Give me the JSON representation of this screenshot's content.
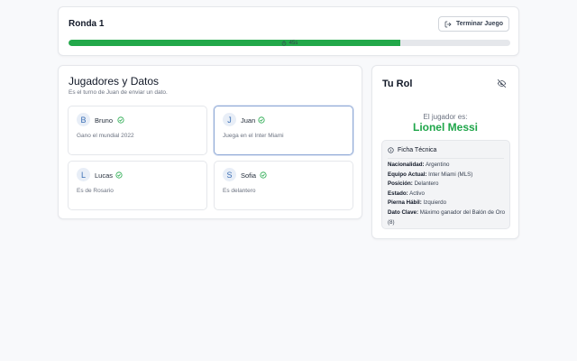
{
  "round": {
    "title": "Ronda 1",
    "end_label": "Terminar Juego",
    "progress_percent": 75,
    "progress_label": "45s"
  },
  "players_panel": {
    "title": "Jugadores y Datos",
    "subtitle": "Es el turno de Juan de enviar un dato.",
    "players": [
      {
        "initial": "B",
        "name": "Bruno",
        "clue": "Gano el mundial 2022",
        "active": false
      },
      {
        "initial": "J",
        "name": "Juan",
        "clue": "Juega en el Inter Miami",
        "active": true
      },
      {
        "initial": "L",
        "name": "Lucas",
        "clue": "Es de Rosario",
        "active": false
      },
      {
        "initial": "S",
        "name": "Sofia",
        "clue": "Es delantero",
        "active": false
      }
    ]
  },
  "role": {
    "title": "Tu Rol",
    "prefix": "El jugador es:",
    "player_name": "Lionel Messi",
    "sheet_title": "Ficha Técnica",
    "sheet": [
      {
        "label": "Nacionalidad:",
        "value": "Argentino"
      },
      {
        "label": "Equipo Actual:",
        "value": "Inter Miami (MLS)"
      },
      {
        "label": "Posición:",
        "value": "Delantero"
      },
      {
        "label": "Estado:",
        "value": "Activo"
      },
      {
        "label": "Pierna Hábil:",
        "value": "Izquierdo"
      },
      {
        "label": "Dato Clave:",
        "value": "Máximo ganador del Balón de Oro (8)"
      }
    ]
  },
  "colors": {
    "accent_green": "#22a84a",
    "active_border": "#8fa9d6",
    "avatar_text": "#3b6fb5"
  },
  "icons": {
    "end": "logout-icon",
    "timer": "timer-icon",
    "check": "check-circle-icon",
    "hide": "eye-off-icon",
    "info": "info-icon"
  }
}
